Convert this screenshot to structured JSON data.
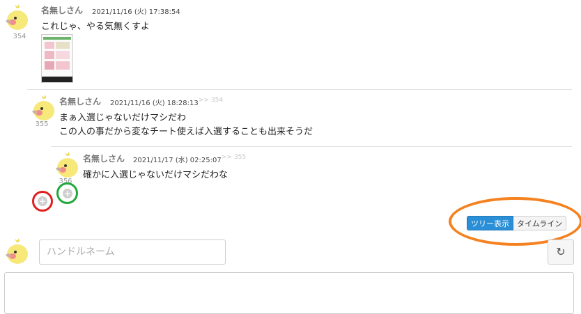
{
  "posts": [
    {
      "author": "名無しさん",
      "date": "2021/11/16 (火) 17:38:54",
      "res_no": "354",
      "reply_to": "",
      "lines": [
        "これじゃ、やる気無くすよ"
      ]
    },
    {
      "author": "名無しさん",
      "date": "2021/11/16 (火) 18:28:13",
      "res_no": "355",
      "reply_to": ">> 354",
      "lines": [
        "まぁ入選じゃないだけマシだわ",
        "この人の事だから変なチート使えば入選することも出来そうだ"
      ]
    },
    {
      "author": "名無しさん",
      "date": "2021/11/17 (水) 02:25:07",
      "res_no": "356",
      "reply_to": ">> 355",
      "lines": [
        "確かに入選じゃないだけマシだわな"
      ]
    }
  ],
  "view_toggle": {
    "tree_label": "ツリー表示",
    "timeline_label": "タイムライン"
  },
  "composer": {
    "handle_placeholder": "ハンドルネーム"
  },
  "annotation_colors": {
    "red": "#e02020",
    "green": "#22a83c",
    "orange": "#f58220"
  }
}
